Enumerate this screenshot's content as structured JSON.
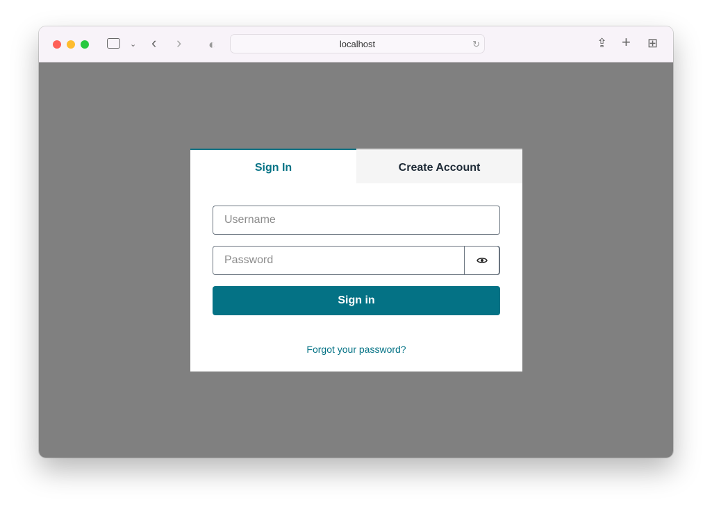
{
  "browser": {
    "url": "localhost"
  },
  "tabs": [
    {
      "label": "Sign In",
      "active": true
    },
    {
      "label": "Create Account",
      "active": false
    }
  ],
  "form": {
    "username_placeholder": "Username",
    "password_placeholder": "Password",
    "submit_label": "Sign in",
    "forgot_link": "Forgot your password?"
  },
  "colors": {
    "accent": "#047285",
    "backdrop": "#808080"
  }
}
